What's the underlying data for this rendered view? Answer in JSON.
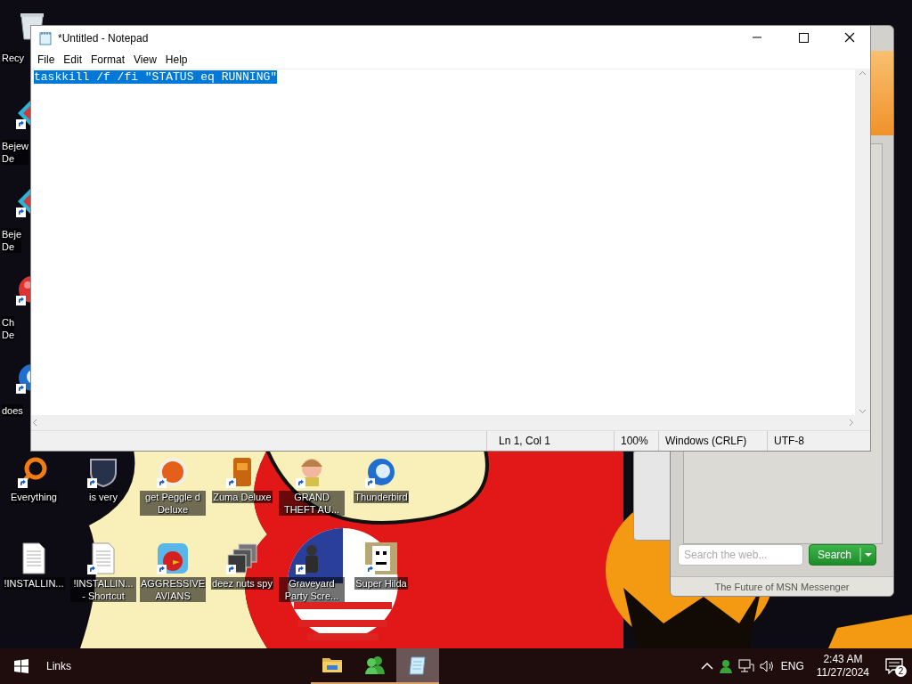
{
  "desktop": {
    "left_icons": [
      {
        "label": "Recy",
        "kind": "recycle-bin",
        "shortcut": false
      },
      {
        "label": "Bejew\nDe",
        "kind": "gem",
        "shortcut": true
      },
      {
        "label": "Beje\nDe",
        "kind": "gem",
        "shortcut": true
      },
      {
        "label": "Ch\nDe",
        "kind": "ball",
        "shortcut": true
      },
      {
        "label": "does",
        "kind": "bird",
        "shortcut": true
      }
    ],
    "icon_rows": [
      [
        {
          "label": "Everything",
          "kind": "ring",
          "shortcut": true
        },
        {
          "label": "is very",
          "kind": "shield",
          "shortcut": true
        },
        {
          "label": "get Peggle d Deluxe",
          "kind": "letter-ball",
          "shortcut": true
        },
        {
          "label": "Zuma Deluxe",
          "kind": "idol",
          "shortcut": true
        },
        {
          "label": "GRAND THEFT AU...",
          "kind": "character",
          "shortcut": true
        },
        {
          "label": "Thunderbird",
          "kind": "bird",
          "shortcut": true
        }
      ],
      [
        {
          "label": "!INSTALLIN...",
          "kind": "document",
          "shortcut": false
        },
        {
          "label": "!INSTALLIN... - Shortcut",
          "kind": "document",
          "shortcut": true
        },
        {
          "label": "AGGRESSIVE AVIANS",
          "kind": "bird-app",
          "shortcut": true
        },
        {
          "label": "deez nuts spy",
          "kind": "stack",
          "shortcut": true
        },
        {
          "label": "Graveyard Party Scre...",
          "kind": "figure",
          "shortcut": true
        },
        {
          "label": "Super Hilda",
          "kind": "pixel",
          "shortcut": true
        }
      ]
    ]
  },
  "messenger_window": {
    "search": {
      "placeholder": "Search the web..."
    },
    "search_button": "Search",
    "footer": "The Future of MSN Messenger"
  },
  "notepad": {
    "title": "*Untitled - Notepad",
    "menu": [
      "File",
      "Edit",
      "Format",
      "View",
      "Help"
    ],
    "content": {
      "text": "taskkill /f /fi \"STATUS eq RUNNING\"",
      "selected": true
    },
    "status_bar": [
      "Ln 1, Col 1",
      "100%",
      "Windows (CRLF)",
      "UTF-8"
    ]
  },
  "taskbar": {
    "links": "Links",
    "apps": [
      {
        "kind": "folder",
        "selected": false
      },
      {
        "kind": "messenger",
        "selected": false
      },
      {
        "kind": "notepad",
        "selected": true
      }
    ],
    "language": "ENG",
    "time": "2:43 AM",
    "date": "11/27/2024",
    "notifications": "2"
  }
}
